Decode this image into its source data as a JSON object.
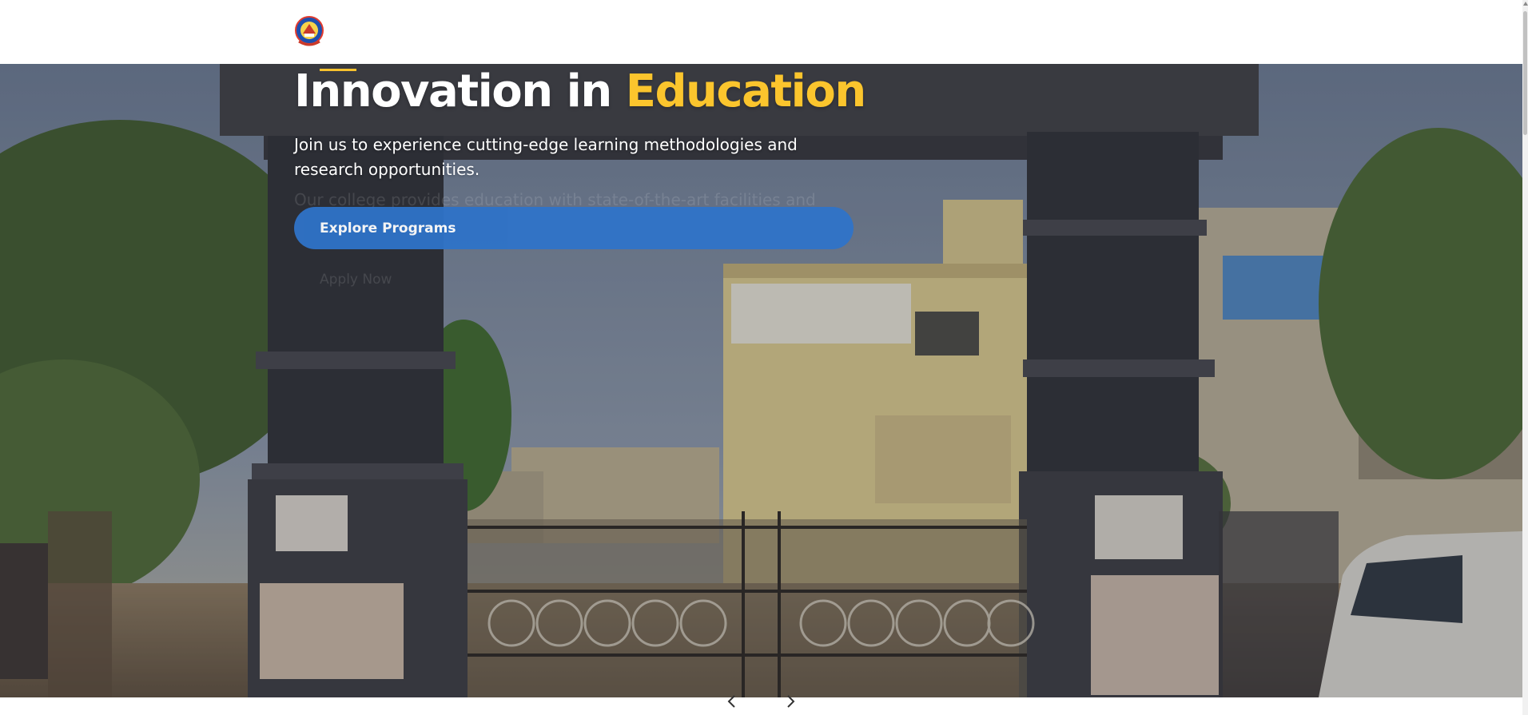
{
  "header": {
    "logo_icon": "college-emblem-icon"
  },
  "hero": {
    "headline_part1": "Innovation in ",
    "headline_highlight": "Education",
    "subtitle": "Join us to experience cutting-edge learning methodologies and research opportunities.",
    "faded_previous_text": "Our college provides education with state-of-the-art facilities and",
    "faded_previous_cta": "Apply Now",
    "cta_label": "Explore Programs"
  },
  "carousel": {
    "prev_icon": "chevron-left-icon",
    "next_icon": "chevron-right-icon"
  },
  "colors": {
    "accent": "#fbc52d",
    "primary_button": "#2f73c8",
    "header_bg": "#ffffff"
  }
}
